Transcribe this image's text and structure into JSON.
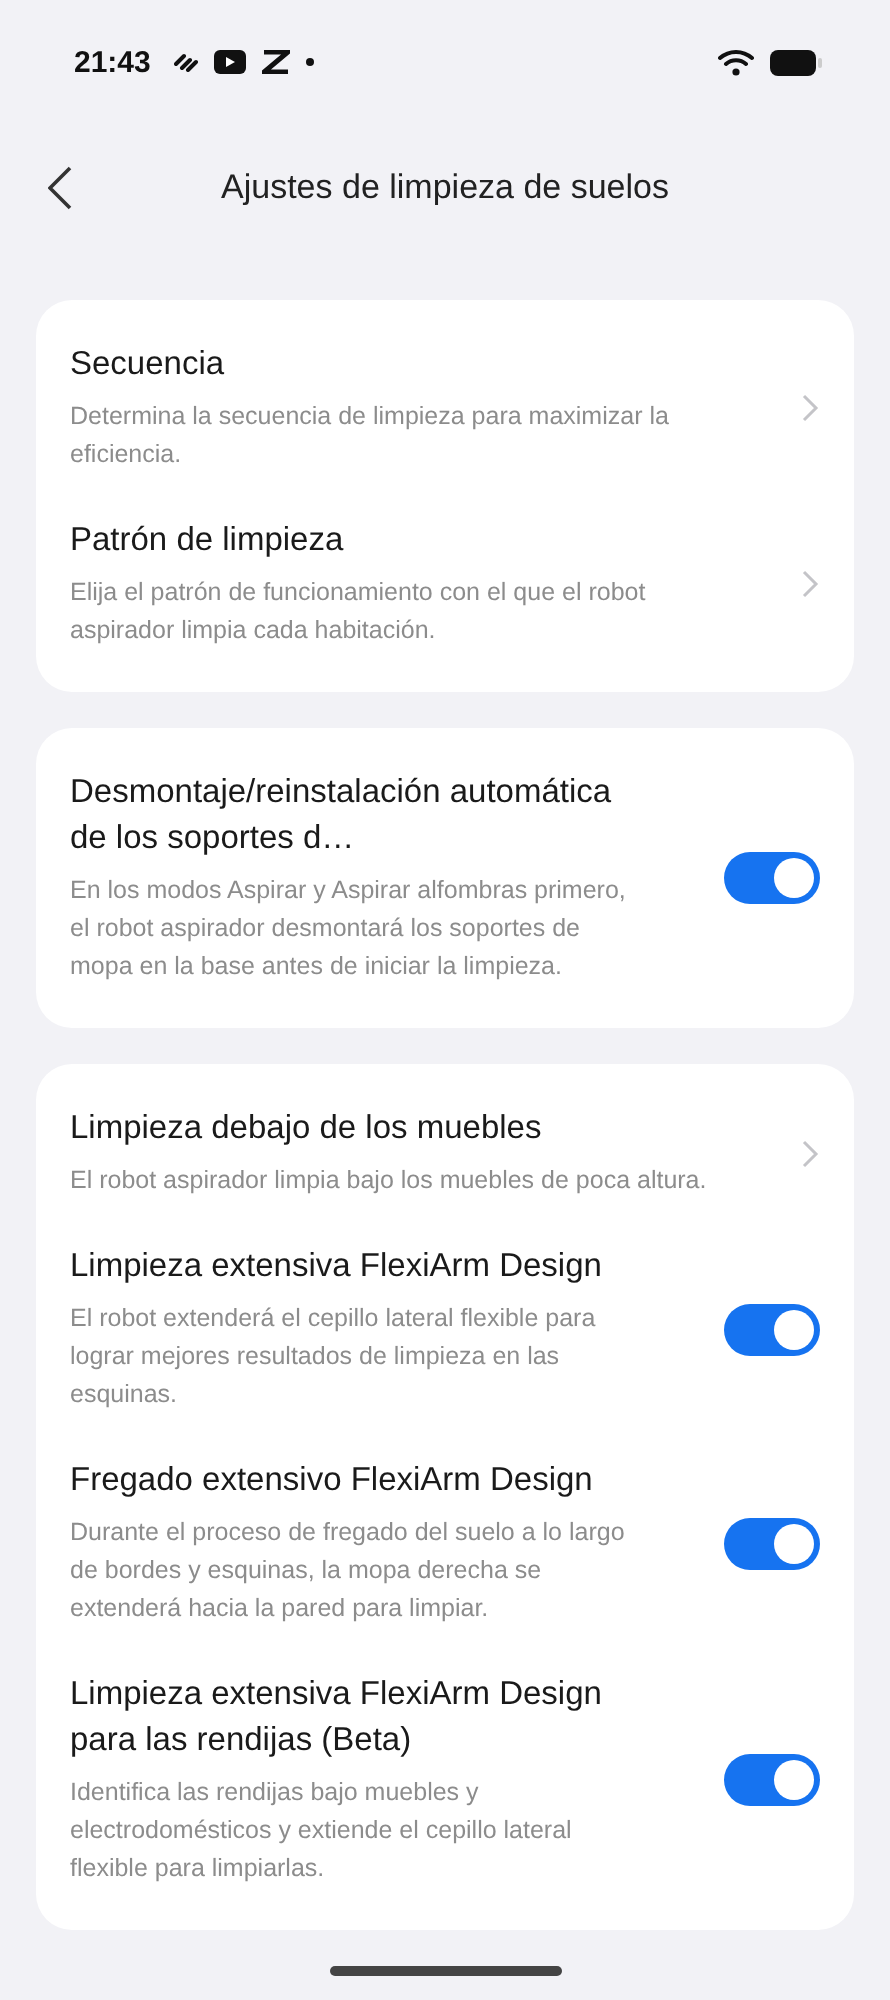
{
  "status_bar": {
    "time": "21:43"
  },
  "header": {
    "title": "Ajustes de limpieza de suelos"
  },
  "groups": [
    {
      "rows": [
        {
          "kind": "link",
          "title": "Secuencia",
          "description": "Determina la secuencia de limpieza para maximizar la eficiencia."
        },
        {
          "kind": "link",
          "title": "Patrón de limpieza",
          "description": "Elija el patrón de funcionamiento con el que el robot aspirador limpia cada habitación."
        }
      ]
    },
    {
      "rows": [
        {
          "kind": "toggle",
          "on": true,
          "title": "Desmontaje/reinstalación automática de los soportes d…",
          "description": "En los modos Aspirar y Aspirar alfombras primero, el robot aspirador desmontará los soportes de mopa en la base antes de iniciar la limpieza."
        }
      ]
    },
    {
      "rows": [
        {
          "kind": "link",
          "title": "Limpieza debajo de los muebles",
          "description": "El robot aspirador limpia bajo los muebles de poca altura."
        },
        {
          "kind": "toggle",
          "on": true,
          "title": "Limpieza extensiva FlexiArm Design",
          "description": "El robot extenderá el cepillo lateral flexible para lograr mejores resultados de limpieza en las esquinas."
        },
        {
          "kind": "toggle",
          "on": true,
          "title": "Fregado extensivo FlexiArm Design",
          "description": "Durante el proceso de fregado del suelo a lo largo de bordes y esquinas, la mopa derecha se extenderá hacia la pared para limpiar."
        },
        {
          "kind": "toggle",
          "on": true,
          "title": "Limpieza extensiva FlexiArm Design para las rendijas (Beta)",
          "description": "Identifica las rendijas bajo muebles y electrodomésticos y extiende el cepillo lateral flexible para limpiarlas."
        }
      ]
    }
  ]
}
